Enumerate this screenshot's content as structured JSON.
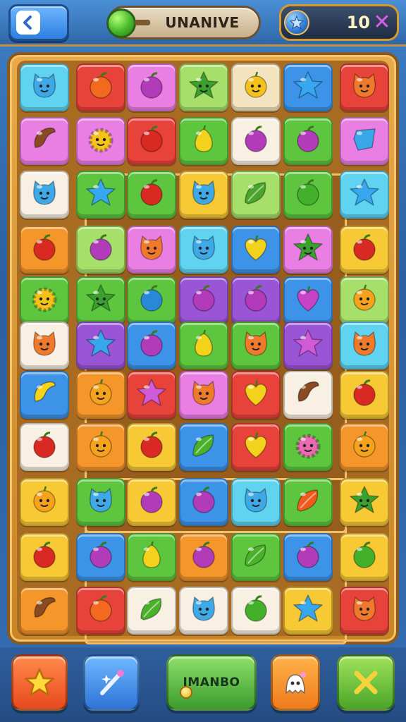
{
  "header": {
    "back_icon": "chevron-left-icon",
    "level_name": "UNANIVE",
    "score_value": "10",
    "score_icon": "star-orb-icon",
    "close_icon": "x-icon"
  },
  "footer": {
    "star_button_icon": "star-icon",
    "magic_button_icon": "magic-wand-icon",
    "center_button_label": "IMANBO",
    "ghost_button_icon": "ghost-icon",
    "cancel_button_icon": "x-icon"
  },
  "colors": {
    "cyan": "#5fd3ef",
    "red": "#e8433a",
    "pink": "#ea7fe3",
    "lime": "#a6e06a",
    "cream": "#f3e3bf",
    "blue": "#3c93e8",
    "green": "#5dc63e",
    "yellow": "#f7c935",
    "orange": "#f5962b",
    "purple": "#9a55d6",
    "white": "#f8f1e3"
  },
  "grid": {
    "rows": 11,
    "cols": 7,
    "tiles": [
      [
        "cyan:blob-face",
        "red:orange-fruit",
        "pink:plum",
        "lime:leaf-star",
        "cream:lemon-face",
        "blue:star",
        "red:cat-face"
      ],
      [
        "pink:bean",
        "pink:sun-face",
        "red:tomato",
        "green:pear",
        "white:plum",
        "green:plum",
        "pink:gem"
      ],
      [
        "white:blob-face",
        "green:star",
        "green:tomato",
        "yellow:blob-face",
        "lime:pea-pod",
        "green:apple",
        "cyan:star"
      ],
      [
        "orange:tomato",
        "lime:plum",
        "pink:cat-face",
        "cyan:blob-face",
        "blue:heart-fruit",
        "pink:leaf-star",
        "yellow:tomato"
      ],
      [
        "green:sun-face",
        "green:leaf-star",
        "green:berry",
        "purple:plum",
        "purple:plum",
        "blue:heart",
        "lime:orange-face"
      ],
      [
        "white:cat-face",
        "purple:star",
        "blue:plum",
        "green:lemon",
        "green:cat-face",
        "purple:gem-star",
        "cyan:cat-face"
      ],
      [
        "blue:banana",
        "orange:orange-face",
        "red:gem-star",
        "pink:cat-face",
        "red:heart-fruit",
        "white:bean",
        "yellow:tomato"
      ],
      [
        "white:tomato",
        "orange:orange-face",
        "yellow:tomato",
        "blue:leaf",
        "red:heart-fruit",
        "green:flower-face",
        "orange:orange-face"
      ],
      [
        "yellow:orange-face",
        "green:blob-face",
        "yellow:plum",
        "blue:plum",
        "cyan:blob-face",
        "green:pepper",
        "yellow:leaf-star"
      ],
      [
        "yellow:tomato",
        "blue:plum",
        "green:pear",
        "orange:plum",
        "green:leaf",
        "blue:plum",
        "yellow:apple"
      ],
      [
        "orange:bean",
        "red:orange-fruit",
        "white:leaf",
        "white:blob-face",
        "white:apple",
        "yellow:star",
        "red:cat-face"
      ]
    ]
  }
}
